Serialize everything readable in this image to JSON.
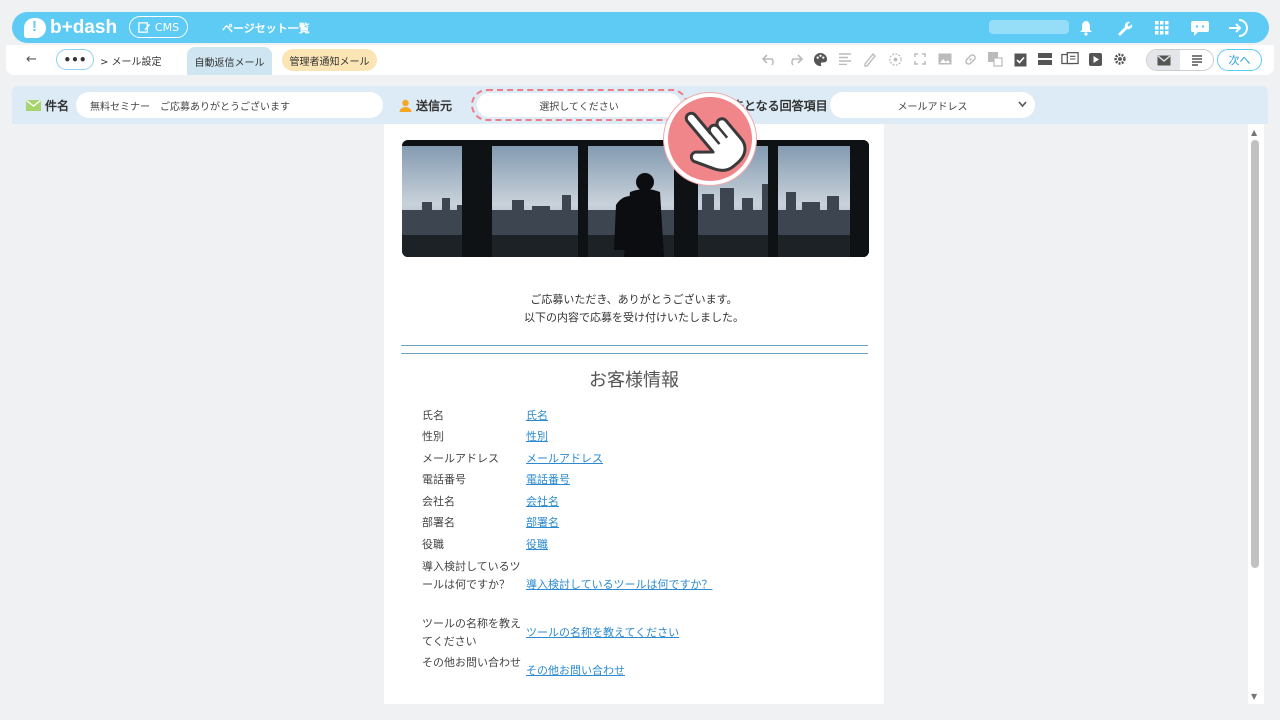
{
  "header": {
    "logo": "b+dash",
    "cms_label": "CMS",
    "page_set_label": "ページセット一覧"
  },
  "toolbar": {
    "back": "←",
    "dots": "•••",
    "breadcrumb": "> メール設定",
    "tabs": [
      {
        "label": "自動返信メール",
        "active": true
      },
      {
        "label": "管理者通知メール",
        "active": false
      }
    ],
    "next_label": "次へ"
  },
  "fields": {
    "subject_label": "件名",
    "subject_value": "無料セミナー　ご応募ありがとうございます",
    "sender_label": "送信元",
    "sender_placeholder": "選択してください",
    "answer_label": "先となる回答項目",
    "answer_value": "メールアドレス"
  },
  "email": {
    "thanks_line1": "ご応募いただき、ありがとうございます。",
    "thanks_line2": "以下の内容で応募を受け付けいたしました。",
    "section_title": "お客様情報",
    "rows": [
      {
        "label": "氏名",
        "value": "氏名"
      },
      {
        "label": "性別",
        "value": "性別"
      },
      {
        "label": "メールアドレス",
        "value": "メールアドレス"
      },
      {
        "label": "電話番号",
        "value": "電話番号"
      },
      {
        "label": "会社名",
        "value": "会社名"
      },
      {
        "label": "部署名",
        "value": "部署名"
      },
      {
        "label": "役職",
        "value": "役職"
      },
      {
        "label": "導入検討しているツールは何ですか？",
        "value": "導入検討しているツールは何ですか？"
      },
      {
        "label": "ツールの名称を教えてください",
        "value": "ツールの名称を教えてください"
      },
      {
        "label": "その他お問い合わせ",
        "value": "その他お問い合わせ"
      }
    ]
  },
  "colors": {
    "header_blue": "#5ecbf5",
    "field_bar": "#dcebf5",
    "highlight": "#ee7d86",
    "link": "#2b8ad0"
  }
}
